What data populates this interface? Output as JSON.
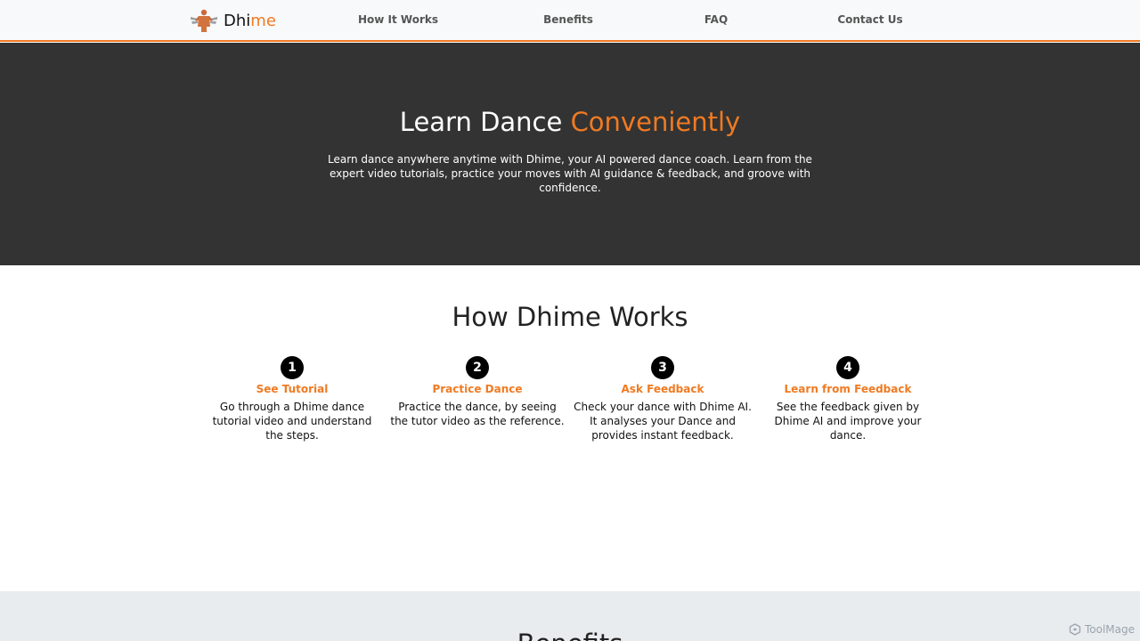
{
  "navbar": {
    "brand_prefix": "Dhi",
    "brand_accent": "me",
    "links": [
      {
        "label": "How It Works"
      },
      {
        "label": "Benefits"
      },
      {
        "label": "FAQ"
      },
      {
        "label": "Contact Us"
      }
    ]
  },
  "hero": {
    "title_main": "Learn Dance",
    "title_accent": "Conveniently",
    "subtitle": "Learn dance anywhere anytime with Dhime, your AI powered dance coach. Learn from the expert video tutorials, practice your moves with AI guidance & feedback, and groove with confidence."
  },
  "how": {
    "title": "How Dhime Works",
    "steps": [
      {
        "number": "1",
        "title": "See Tutorial",
        "description": "Go through a Dhime dance tutorial video and understand the steps."
      },
      {
        "number": "2",
        "title": "Practice Dance",
        "description": "Practice the dance, by seeing the tutor video as the reference."
      },
      {
        "number": "3",
        "title": "Ask Feedback",
        "description": "Check your dance with Dhime AI. It analyses your Dance and provides instant feedback."
      },
      {
        "number": "4",
        "title": "Learn from Feedback",
        "description": "See the feedback given by Dhime AI and improve your dance."
      }
    ]
  },
  "benefits": {
    "title": "Benefits"
  },
  "watermark": {
    "label": "ToolMage"
  },
  "colors": {
    "accent": "#f07a22",
    "hero_bg": "#333333",
    "navbar_bg": "#f8f9fa",
    "benefits_bg": "#e9ecef"
  },
  "icons": {
    "logo": "dancer-logo-icon",
    "watermark": "toolmage-logo-icon"
  }
}
